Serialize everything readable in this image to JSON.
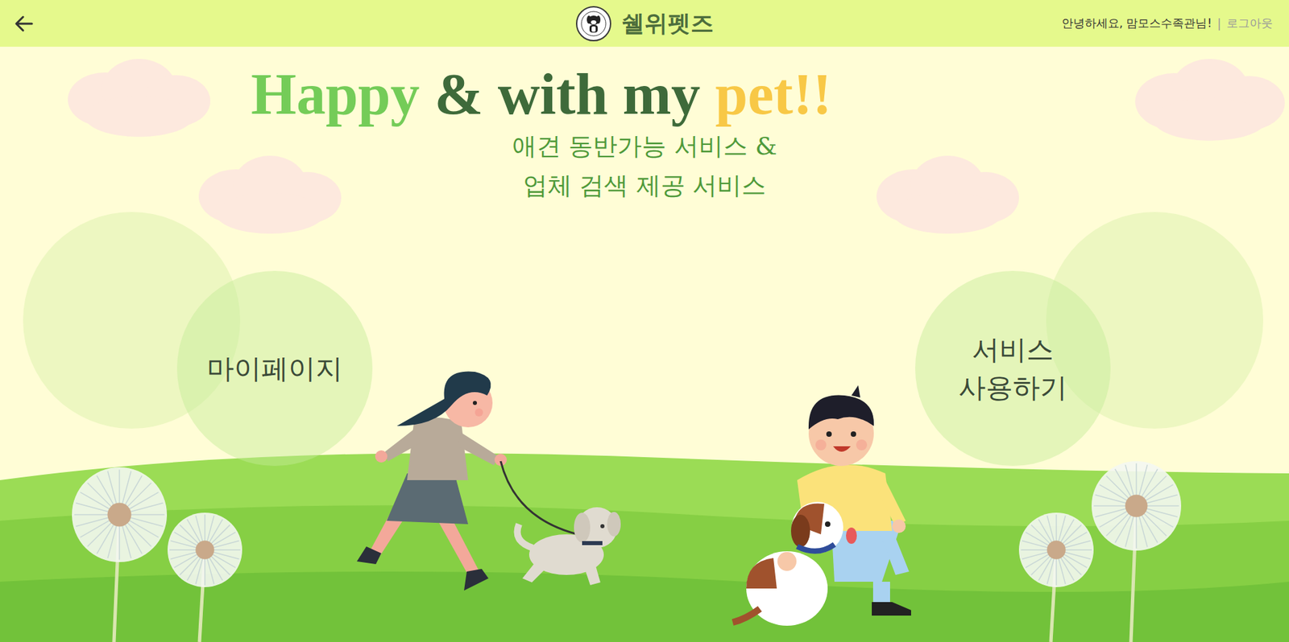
{
  "header": {
    "brand": "쉘위펫즈",
    "greeting": "안녕하세요, 맘모스수족관님!",
    "separator": "|",
    "logout": "로그아웃"
  },
  "hero": {
    "title": [
      {
        "text": "Happy",
        "color": "#74cc58"
      },
      {
        "text": "& with my",
        "color": "#3e6a3a"
      },
      {
        "text": "pet!!",
        "color": "#f8c846"
      }
    ],
    "subtitle": [
      "애견 동반가능 서비스 &",
      "업체 검색 제공 서비스"
    ]
  },
  "menu": [
    {
      "lines": [
        "마이페이지"
      ]
    },
    {
      "lines": [
        "서비스",
        "사용하기"
      ]
    }
  ]
}
